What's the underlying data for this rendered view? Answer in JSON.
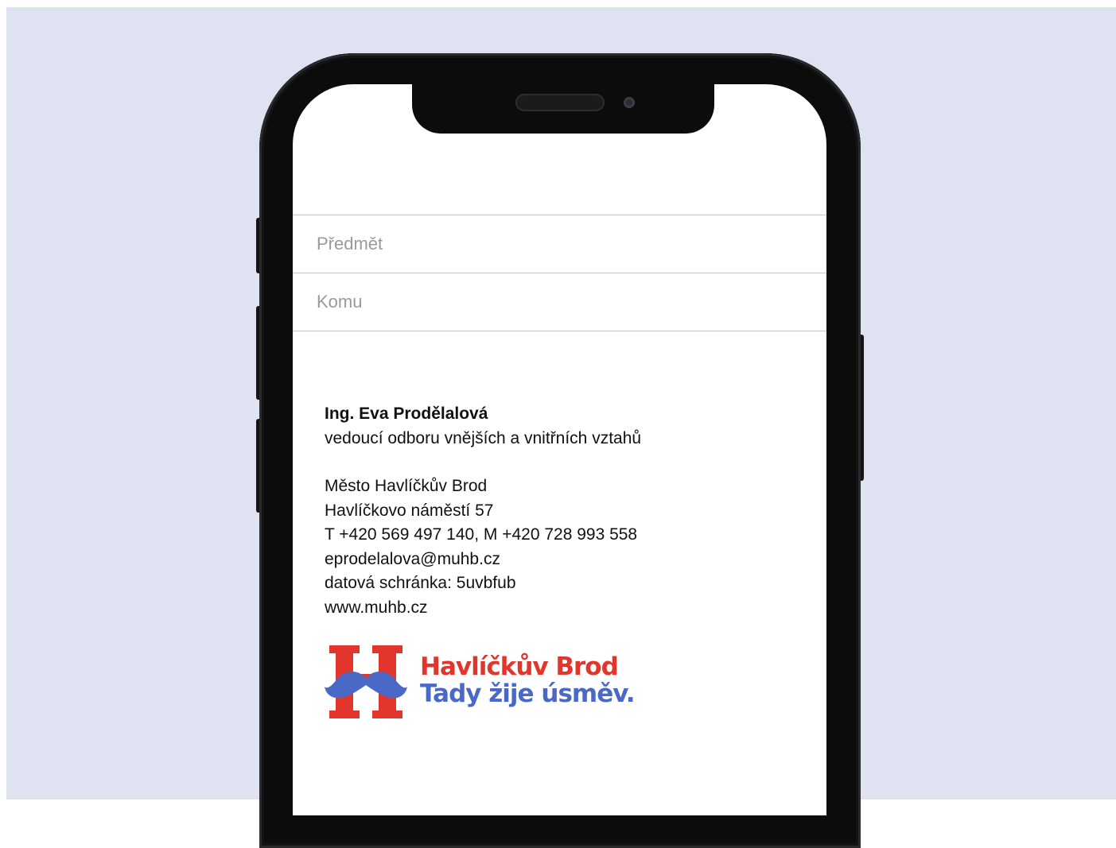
{
  "compose": {
    "subject_placeholder": "Předmět",
    "to_placeholder": "Komu"
  },
  "signature": {
    "name": "Ing. Eva Prodělalová",
    "position": "vedoucí odboru vnějších a vnitřních vztahů",
    "organization": "Město Havlíčkův Brod",
    "address": "Havlíčkovo náměstí 57",
    "phones": "T +420 569 497 140, M +420 728 993 558",
    "email": "eprodelalova@muhb.cz",
    "data_box": "datová schránka: 5uvbfub",
    "website": "www.muhb.cz"
  },
  "logo": {
    "line1": "Havlíčkův Brod",
    "line2": "Tady žije úsměv.",
    "colors": {
      "red": "#e2352b",
      "blue": "#4a68c6"
    }
  }
}
